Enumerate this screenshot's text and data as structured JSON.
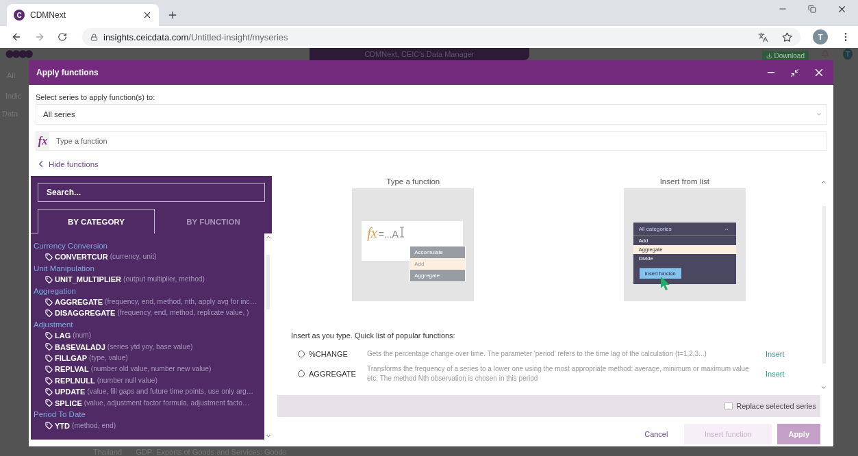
{
  "browser": {
    "tab": {
      "icon_letter": "C",
      "title": "CDMNext"
    },
    "url": {
      "host": "insights.ceicdata.com",
      "path": "/Untitled-insight/myseries"
    },
    "profile_letter": "T"
  },
  "app": {
    "title": "CDMNext, CEIC's Data Manager",
    "download": "Download",
    "avatar": "T",
    "left_fragments": [
      "All",
      "Indic",
      "Data"
    ],
    "bottom_row": {
      "country": "Thailand",
      "series": "GDP: Exports of Goods and Services: Goods"
    }
  },
  "modal": {
    "title": "Apply functions",
    "series_label": "Select series to apply function(s) to:",
    "series_select": {
      "value": "All series"
    },
    "function_input": {
      "icon": "fx",
      "placeholder": "Type a function"
    },
    "hide_link": "Hide functions",
    "search": {
      "placeholder": "Search..."
    },
    "tabs": [
      {
        "label": "BY CATEGORY",
        "selected": true
      },
      {
        "label": "BY FUNCTION",
        "selected": false
      }
    ],
    "categories": [
      {
        "name": "Currency Conversion",
        "functions": [
          {
            "name": "CONVERTCUR",
            "params": "(currency, unit)"
          }
        ]
      },
      {
        "name": "Unit Manipulation",
        "functions": [
          {
            "name": "UNIT_MULTIPLIER",
            "params": "(output multiplier, method)"
          }
        ]
      },
      {
        "name": "Aggregation",
        "functions": [
          {
            "name": "AGGREGATE",
            "params": "(frequency, end, method, nth, apply avg for inc…"
          },
          {
            "name": "DISAGGREGATE",
            "params": "(frequency, end, method, replicate value, )"
          }
        ]
      },
      {
        "name": "Adjustment",
        "functions": [
          {
            "name": "LAG",
            "params": "(num)"
          },
          {
            "name": "BASEVALADJ",
            "params": "(series ytd yoy, base value)"
          },
          {
            "name": "FILLGAP",
            "params": "(type, value)"
          },
          {
            "name": "REPLVAL",
            "params": "(number old value, number new value)"
          },
          {
            "name": "REPLNULL",
            "params": "(number null value)"
          },
          {
            "name": "UPDATE",
            "params": "(value, fill gaps and future time points, use only arg…"
          },
          {
            "name": "SPLICE",
            "params": "(value, adjustment factor formula, adjustment facto…"
          }
        ]
      },
      {
        "name": "Period To Date",
        "functions": [
          {
            "name": "YTD",
            "params": "(method, end)"
          }
        ]
      }
    ],
    "illustrations": [
      {
        "kind": "type",
        "title": "Type a function",
        "icon": "fx",
        "typed": "=...A",
        "items": [
          {
            "label": "Accomulate",
            "selected": false
          },
          {
            "label": "Add",
            "selected": true
          },
          {
            "label": "Aggregate",
            "selected": false
          }
        ]
      },
      {
        "kind": "list",
        "title": "Insert from list",
        "header": "All categories",
        "items": [
          {
            "label": "Add",
            "selected": false
          },
          {
            "label": "Aggregate",
            "selected": true
          },
          {
            "label": "Divide",
            "selected": false
          }
        ],
        "button": "Insert funcion"
      }
    ],
    "popular": {
      "heading": "Insert as you type. Quick list of popular functions:",
      "items": [
        {
          "name": "%CHANGE",
          "description": "Gets the percentage change over time. The parameter 'period' refers to the time lag of the calculation (t=1,2,3...)",
          "action": "Insert",
          "selected": false
        },
        {
          "name": "AGGREGATE",
          "description": "Transforms the frequency of a series to a lower one using the most appropriate method: average, minimum or maximum value etc. The method Nth observation is chosen in this period",
          "action": "Insert",
          "selected": false
        }
      ]
    },
    "replace": {
      "label": "Replace selected series",
      "checked": false
    },
    "buttons": {
      "cancel": "Cancel",
      "insert": {
        "label": "Insert function",
        "disabled": true
      },
      "apply": "Apply"
    }
  }
}
